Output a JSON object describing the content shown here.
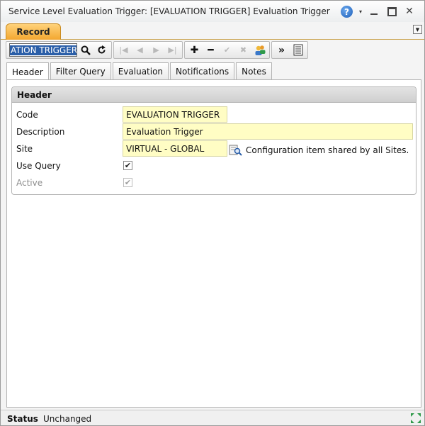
{
  "window": {
    "title": "Service Level Evaluation Trigger: [EVALUATION TRIGGER] Evaluation Trigger",
    "help_glyph": "?",
    "menu_glyph": "▾",
    "close_glyph": "✕"
  },
  "record_tab": {
    "label": "Record",
    "dropdown_glyph": "▼"
  },
  "toolbar": {
    "code_value": "ATION TRIGGER",
    "icons": [
      "search-icon",
      "refresh-icon",
      "first-record-icon",
      "previous-record-icon",
      "next-record-icon",
      "last-record-icon",
      "add-icon",
      "remove-icon",
      "confirm-icon",
      "cancel-icon",
      "users-icon",
      "more-icon",
      "list-icon"
    ]
  },
  "tabs": [
    {
      "label": "Header",
      "active": true
    },
    {
      "label": "Filter Query",
      "active": false
    },
    {
      "label": "Evaluation",
      "active": false
    },
    {
      "label": "Notifications",
      "active": false
    },
    {
      "label": "Notes",
      "active": false
    }
  ],
  "header_section": {
    "title": "Header",
    "code_label": "Code",
    "code_value": "EVALUATION TRIGGER",
    "description_label": "Description",
    "description_value": "Evaluation Trigger",
    "site_label": "Site",
    "site_value": "VIRTUAL - GLOBAL",
    "site_note": "Configuration item shared by all Sites.",
    "use_query_label": "Use Query",
    "use_query_checked": true,
    "active_label": "Active",
    "active_checked": true
  },
  "status": {
    "label": "Status",
    "value": "Unchanged"
  },
  "colors": {
    "record_tab": "#f3a730",
    "required_field": "#fffdc4",
    "selection": "#2a5ea8"
  }
}
